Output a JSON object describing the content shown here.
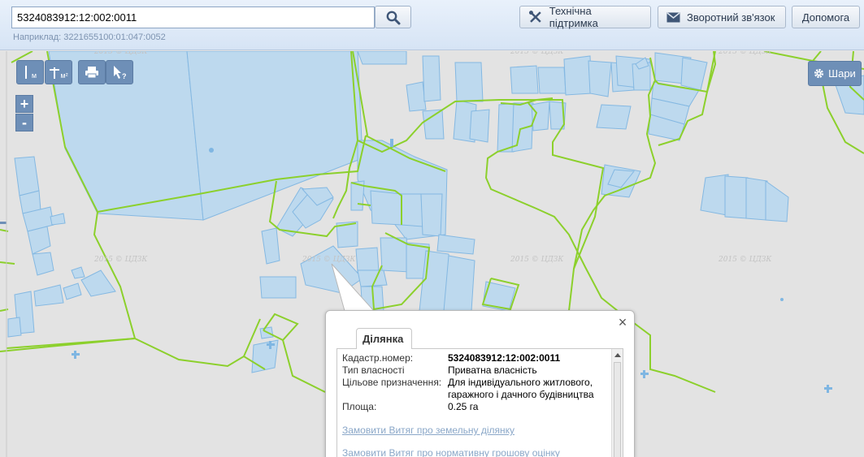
{
  "header": {
    "search_value": "5324083912:12:002:0011",
    "example_text": "Наприклад: 3221655100:01:047:0052",
    "support_label": "Технічна підтримка",
    "feedback_label": "Зворотний зв'язок",
    "help_label": "Допомога",
    "search_icon": "search-icon"
  },
  "map_tools": {
    "measure_distance_label": "м",
    "measure_area_label": "м²",
    "zoom_in": "+",
    "zoom_out": "-",
    "layers_label": "Шари",
    "watermark": "2015 © ЦДЗК"
  },
  "popup": {
    "close": "×",
    "tab_label": "Ділянка",
    "rows": [
      {
        "label": "Кадастр.номер:",
        "value": "5324083912:12:002:0011"
      },
      {
        "label": "Тип власності",
        "value": "Приватна власність"
      },
      {
        "label": "Цільове призначення:",
        "value": "Для індивідуального житлового, гаражного і дачного будівництва"
      },
      {
        "label": "Площа:",
        "value": "0.25 га"
      }
    ],
    "link1": "Замовити Витяг про земельну ділянку",
    "link2": "Замовити Витяг про нормативну грошову оцінку"
  },
  "colors": {
    "parcel_fill": "#b9d8ef",
    "parcel_stroke": "#7fb6e2",
    "boundary": "#8cd02c",
    "tool_bg": "#6e8fb7"
  }
}
